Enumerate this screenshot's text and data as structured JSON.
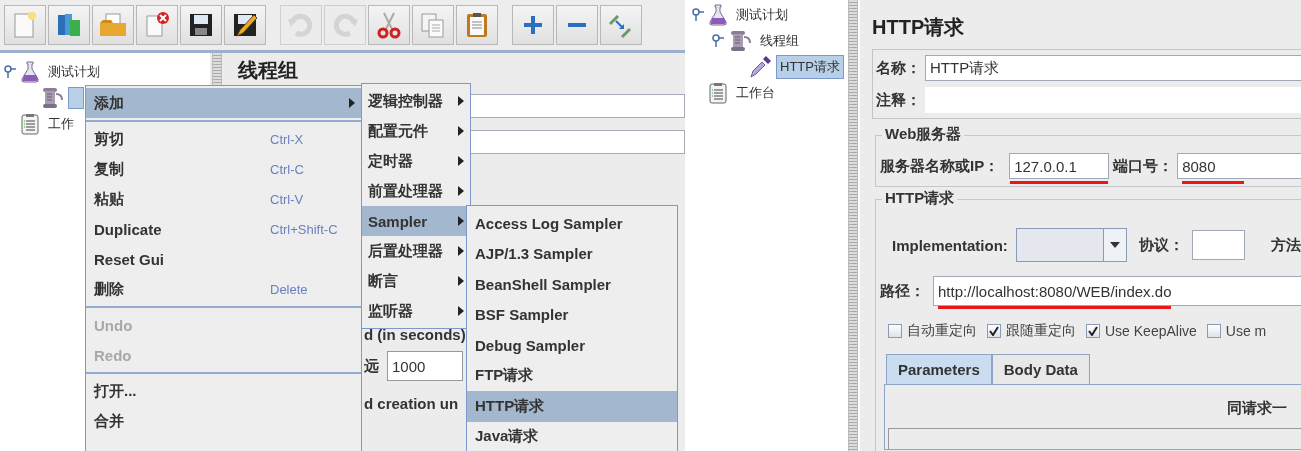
{
  "left_window": {
    "toolbar": [
      [
        {
          "kind": "new",
          "disabled": false
        },
        {
          "kind": "templates",
          "disabled": false
        },
        {
          "kind": "open",
          "disabled": false
        },
        {
          "kind": "close",
          "disabled": false
        },
        {
          "kind": "save",
          "disabled": false
        },
        {
          "kind": "save-as",
          "disabled": false
        }
      ],
      [
        {
          "kind": "undo",
          "disabled": true
        },
        {
          "kind": "redo",
          "disabled": true
        },
        {
          "kind": "cut",
          "disabled": false
        },
        {
          "kind": "copy",
          "disabled": false
        },
        {
          "kind": "paste",
          "disabled": false
        }
      ],
      [
        {
          "kind": "expand",
          "disabled": false
        },
        {
          "kind": "collapse",
          "disabled": false
        },
        {
          "kind": "toggle",
          "disabled": false
        }
      ]
    ],
    "tree": [
      {
        "label": "测试计划",
        "kind": "flask",
        "expanded": true,
        "selected": false,
        "children": [
          {
            "kind": "spool",
            "selected": true
          }
        ]
      },
      {
        "label": "工作",
        "kind": "clipboard",
        "selected": false
      }
    ],
    "editor_panel": {
      "title": "线程组",
      "ramp_label": "d (in seconds)",
      "loop_label": "远",
      "loop_value": "1000",
      "delay_label": "d creation un"
    },
    "context_menu": [
      {
        "kind": "submenu",
        "label": "添加",
        "selected": true
      },
      {
        "kind": "separator"
      },
      {
        "kind": "item",
        "label": "剪切",
        "shortcut": "Ctrl-X",
        "disabled": false
      },
      {
        "kind": "item",
        "label": "复制",
        "shortcut": "Ctrl-C",
        "disabled": false
      },
      {
        "kind": "item",
        "label": "粘贴",
        "shortcut": "Ctrl-V",
        "disabled": false
      },
      {
        "kind": "item",
        "label": "Duplicate",
        "shortcut": "Ctrl+Shift-C",
        "disabled": false
      },
      {
        "kind": "item",
        "label": "Reset Gui",
        "disabled": false
      },
      {
        "kind": "item",
        "label": "删除",
        "shortcut": "Delete",
        "disabled": false
      },
      {
        "kind": "separator"
      },
      {
        "kind": "item",
        "label": "Undo",
        "disabled": true
      },
      {
        "kind": "item",
        "label": "Redo",
        "disabled": true
      },
      {
        "kind": "separator"
      },
      {
        "kind": "item",
        "label": "打开...",
        "disabled": false
      },
      {
        "kind": "item",
        "label": "合并",
        "disabled": false
      }
    ],
    "add_submenu": [
      {
        "label": "逻辑控制器",
        "selected": false
      },
      {
        "label": "配置元件",
        "selected": false
      },
      {
        "label": "定时器",
        "selected": false
      },
      {
        "label": "前置处理器",
        "selected": false
      },
      {
        "label": "Sampler",
        "selected": true
      },
      {
        "label": "后置处理器",
        "selected": false
      },
      {
        "label": "断言",
        "selected": false
      },
      {
        "label": "监听器",
        "selected": false
      }
    ],
    "sampler_submenu": [
      {
        "label": "Access Log Sampler",
        "selected": false
      },
      {
        "label": "AJP/1.3 Sampler",
        "selected": false
      },
      {
        "label": "BeanShell Sampler",
        "selected": false
      },
      {
        "label": "BSF Sampler",
        "selected": false
      },
      {
        "label": "Debug Sampler",
        "selected": false
      },
      {
        "label": "FTP请求",
        "selected": false
      },
      {
        "label": "HTTP请求",
        "selected": true
      },
      {
        "label": "Java请求",
        "selected": false
      }
    ]
  },
  "right_window": {
    "tree": [
      {
        "label": "测试计划",
        "kind": "flask",
        "expanded": true,
        "selected": false,
        "children": [
          {
            "label": "线程组",
            "kind": "spool",
            "expanded": true,
            "selected": false,
            "children": [
              {
                "label": "HTTP请求",
                "kind": "pipette",
                "selected": true
              }
            ]
          }
        ]
      },
      {
        "label": "工作台",
        "kind": "clipboard",
        "selected": false
      }
    ],
    "title": "HTTP请求",
    "name": {
      "label": "名称：",
      "value": "HTTP请求"
    },
    "comment": {
      "label": "注释："
    },
    "web_server": {
      "legend": "Web服务器",
      "server_label": "服务器名称或IP：",
      "server_value": "127.0.0.1",
      "server_underlined": true,
      "port_label": "端口号：",
      "port_value": "8080",
      "port_underlined": true
    },
    "http_request": {
      "legend": "HTTP请求",
      "implementation_label": "Implementation:",
      "protocol_label": "协议：",
      "method_label": "方法",
      "path_label": "路径：",
      "path_value": "http://localhost:8080/WEB/index.do",
      "path_underlined": true
    },
    "options": [
      {
        "label": "自动重定向",
        "checked": false
      },
      {
        "label": "跟随重定向",
        "checked": true
      },
      {
        "label": "Use KeepAlive",
        "checked": true
      },
      {
        "label": "Use m",
        "checked": false
      }
    ],
    "tabs": [
      {
        "label": "Parameters",
        "selected": true
      },
      {
        "label": "Body Data",
        "selected": false
      }
    ],
    "parameters_caption": "同请求一"
  }
}
